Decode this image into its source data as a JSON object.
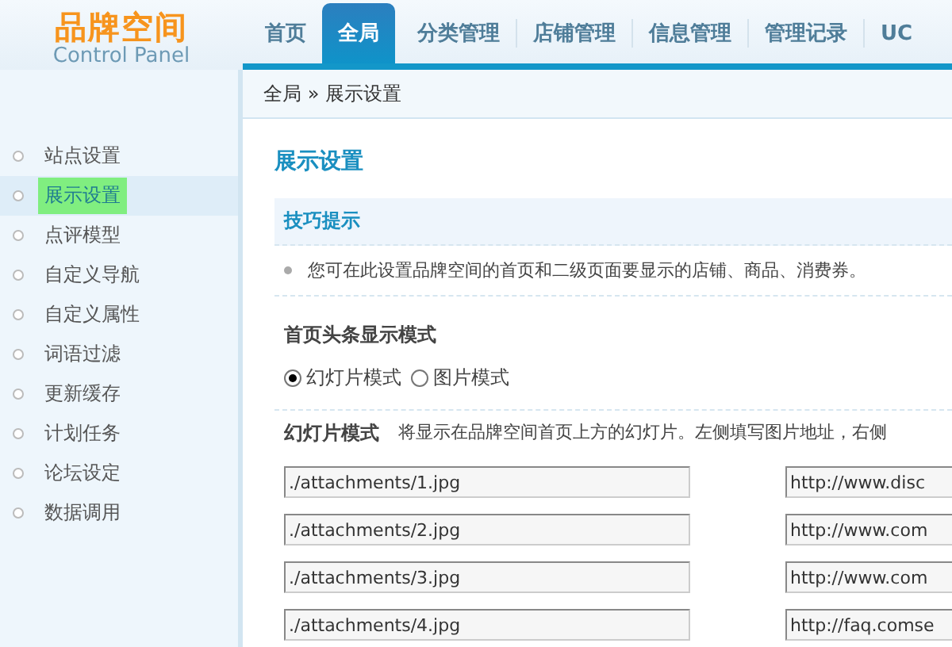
{
  "logo": {
    "title": "品牌空间",
    "subtitle": "Control Panel"
  },
  "nav": [
    {
      "label": "首页",
      "selected": false
    },
    {
      "label": "全局",
      "selected": true
    },
    {
      "label": "分类管理",
      "selected": false
    },
    {
      "label": "店铺管理",
      "selected": false
    },
    {
      "label": "信息管理",
      "selected": false
    },
    {
      "label": "管理记录",
      "selected": false
    },
    {
      "label": "UC",
      "selected": false
    }
  ],
  "breadcrumb": "全局 » 展示设置",
  "sidebar": [
    {
      "label": "站点设置",
      "selected": false
    },
    {
      "label": "展示设置",
      "selected": true
    },
    {
      "label": "点评模型",
      "selected": false
    },
    {
      "label": "自定义导航",
      "selected": false
    },
    {
      "label": "自定义属性",
      "selected": false
    },
    {
      "label": "词语过滤",
      "selected": false
    },
    {
      "label": "更新缓存",
      "selected": false
    },
    {
      "label": "计划任务",
      "selected": false
    },
    {
      "label": "论坛设定",
      "selected": false
    },
    {
      "label": "数据调用",
      "selected": false
    }
  ],
  "page_title": "展示设置",
  "tips": {
    "title": "技巧提示",
    "items": [
      "您可在此设置品牌空间的首页和二级页面要显示的店铺、商品、消费券。"
    ]
  },
  "display_mode": {
    "label": "首页头条显示模式",
    "options": [
      {
        "label": "幻灯片模式",
        "selected": true
      },
      {
        "label": "图片模式",
        "selected": false
      }
    ]
  },
  "slideshow": {
    "label": "幻灯片模式",
    "description": "将显示在品牌空间首页上方的幻灯片。左侧填写图片地址，右侧",
    "rows": [
      {
        "image": "./attachments/1.jpg",
        "link": "http://www.disc"
      },
      {
        "image": "./attachments/2.jpg",
        "link": "http://www.com"
      },
      {
        "image": "./attachments/3.jpg",
        "link": "http://www.com"
      },
      {
        "image": "./attachments/4.jpg",
        "link": "http://faq.comse"
      }
    ]
  }
}
